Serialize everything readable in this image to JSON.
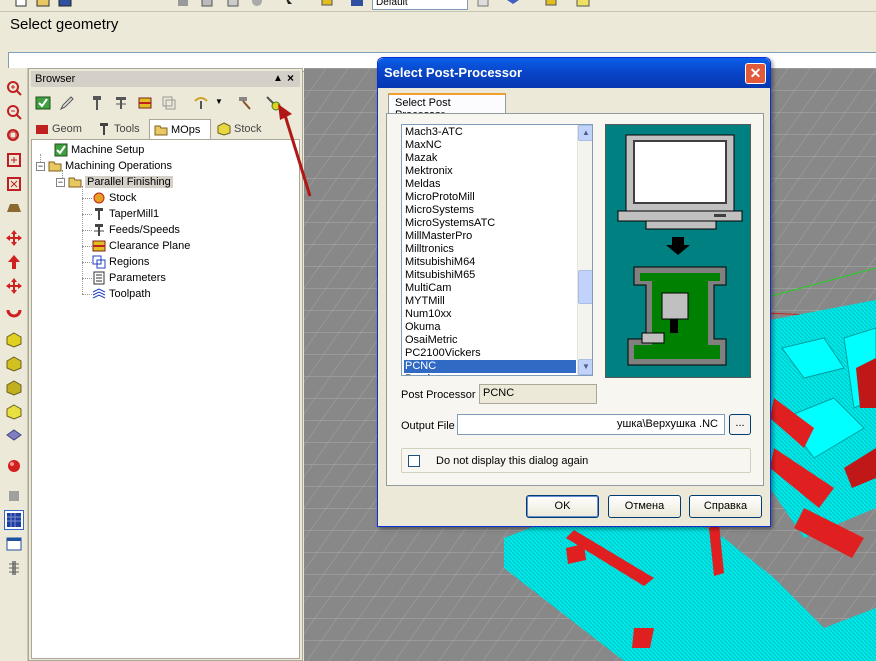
{
  "prompt": {
    "text": "Select geometry",
    "command_value": ""
  },
  "top_toolbar": {
    "tool_dropdown_value": "Default"
  },
  "browser": {
    "title": "Browser",
    "pin_glyph": "▲",
    "close_glyph": "×",
    "tabs": [
      {
        "label": "Geom",
        "icon": "geometry-icon"
      },
      {
        "label": "Tools",
        "icon": "tools-icon"
      },
      {
        "label": "MOps",
        "icon": "mops-folder-icon"
      },
      {
        "label": "Stock",
        "icon": "stock-icon"
      }
    ],
    "active_tab": "MOps",
    "tree": {
      "machine_setup": "Machine Setup",
      "machining_operations": "Machining Operations",
      "parallel_finishing": "Parallel Finishing",
      "children": [
        "Stock",
        "TaperMill1",
        "Feeds/Speeds",
        "Clearance Plane",
        "Regions",
        "Parameters",
        "Toolpath"
      ]
    }
  },
  "dialog": {
    "title": "Select Post-Processor",
    "close_glyph": "✕",
    "tab_label": "Select Post Processor",
    "list_items": [
      "Mach3-ATC",
      "MaxNC",
      "Mazak",
      "Mektronix",
      "Meldas",
      "MicroProtoMill",
      "MicroSystems",
      "MicroSystemsATC",
      "MillMasterPro",
      "Milltronics",
      "MitsubishiM64",
      "MitsubishiM65",
      "MultiCam",
      "MYTMill",
      "Num10xx",
      "Okuma",
      "OsaiMetric",
      "PC2100Vickers",
      "PCNC",
      "Procix"
    ],
    "selected_item": "PCNC",
    "post_processor_label": "Post Processor",
    "post_processor_value": "PCNC",
    "output_file_label": "Output File",
    "output_file_value": "ушка\\Верхушка .NC",
    "browse_label": "...",
    "checkbox_label": "Do not display this dialog again",
    "checkbox_checked": false,
    "ok_label": "OK",
    "cancel_label": "Отмена",
    "help_label": "Справка"
  },
  "colors": {
    "title_bar": "#0844c8",
    "selection": "#316ac5",
    "preview_background": "#008080",
    "viewport_background": "#888888",
    "toolpath": "#00ffff",
    "annotation_arrow": "#b01818"
  }
}
